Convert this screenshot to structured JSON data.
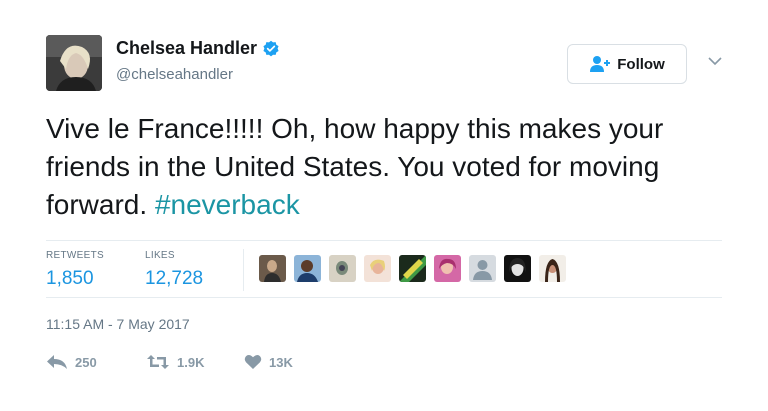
{
  "user": {
    "name": "Chelsea Handler",
    "handle": "@chelseahandler",
    "verified": true
  },
  "follow_label": "Follow",
  "tweet": {
    "text": "Vive le France!!!!! Oh, how happy this makes your friends in the United States. You voted for moving forward. ",
    "hashtag": "#neverback"
  },
  "stats": {
    "retweets_label": "RETWEETS",
    "retweets": "1,850",
    "likes_label": "LIKES",
    "likes": "12,728"
  },
  "likers_count_shown": 9,
  "timestamp": "11:15 AM - 7 May 2017",
  "actions": {
    "replies": "250",
    "retweets": "1.9K",
    "likes": "13K"
  },
  "colors": {
    "accent": "#1b95e0",
    "hashtag": "#1b95a4",
    "muted": "#657786",
    "verified": "#1da1f2"
  }
}
